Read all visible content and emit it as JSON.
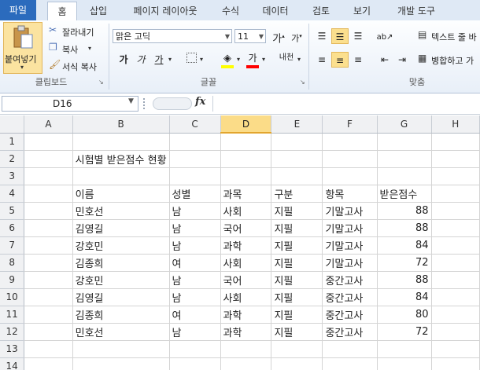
{
  "tabs": [
    "파일",
    "홈",
    "삽입",
    "페이지 레이아웃",
    "수식",
    "데이터",
    "검토",
    "보기",
    "개발 도구"
  ],
  "ribbon": {
    "clipboard": {
      "paste": "붙여넣기",
      "cut": "잘라내기",
      "copy": "복사",
      "format_painter": "서식 복사",
      "label": "클립보드"
    },
    "font": {
      "name": "맑은 고딕",
      "size": "11",
      "grow": "가",
      "shrink": "가",
      "bold": "가",
      "italic": "가",
      "underline": "가",
      "phonetic": "내천",
      "label": "글꼴"
    },
    "alignment": {
      "wrap_text": "텍스트 줄 바",
      "merge_center": "병합하고 가",
      "label": "맞춤"
    },
    "colors": {
      "highlight": "#ffff00",
      "font_color": "#ff0000"
    }
  },
  "formula_bar": {
    "name_box": "D16",
    "fx": "fx",
    "formula": ""
  },
  "columns": [
    "A",
    "B",
    "C",
    "D",
    "E",
    "F",
    "G",
    "H"
  ],
  "selected_column": "D",
  "rows": [
    [
      "",
      "",
      "",
      "",
      "",
      "",
      "",
      ""
    ],
    [
      "",
      "시험별 받은점수 현황",
      "",
      "",
      "",
      "",
      "",
      ""
    ],
    [
      "",
      "",
      "",
      "",
      "",
      "",
      "",
      ""
    ],
    [
      "",
      "이름",
      "성별",
      "과목",
      "구분",
      "항목",
      "받은점수",
      ""
    ],
    [
      "",
      "민호선",
      "남",
      "사회",
      "지필",
      "기말고사",
      "88",
      ""
    ],
    [
      "",
      "김영길",
      "남",
      "국어",
      "지필",
      "기말고사",
      "88",
      ""
    ],
    [
      "",
      "강호민",
      "남",
      "과학",
      "지필",
      "기말고사",
      "84",
      ""
    ],
    [
      "",
      "김종희",
      "여",
      "사회",
      "지필",
      "기말고사",
      "72",
      ""
    ],
    [
      "",
      "강호민",
      "남",
      "국어",
      "지필",
      "중간고사",
      "88",
      ""
    ],
    [
      "",
      "김영길",
      "남",
      "사회",
      "지필",
      "중간고사",
      "84",
      ""
    ],
    [
      "",
      "김종희",
      "여",
      "과학",
      "지필",
      "중간고사",
      "80",
      ""
    ],
    [
      "",
      "민호선",
      "남",
      "과학",
      "지필",
      "중간고사",
      "72",
      ""
    ],
    [
      "",
      "",
      "",
      "",
      "",
      "",
      "",
      ""
    ],
    [
      "",
      "",
      "",
      "",
      "",
      "",
      "",
      ""
    ]
  ]
}
